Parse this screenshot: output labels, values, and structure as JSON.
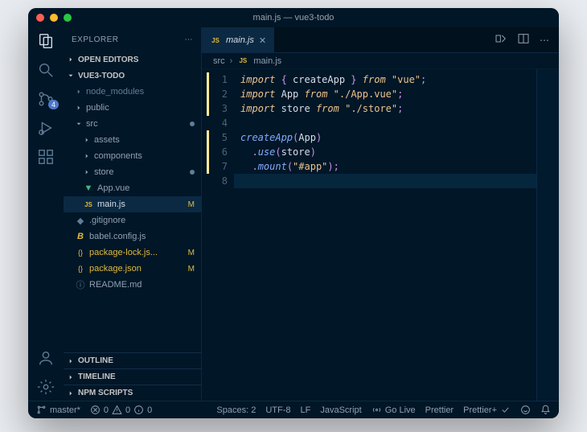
{
  "window": {
    "title": "main.js — vue3-todo"
  },
  "explorer": {
    "title": "EXPLORER",
    "sections": {
      "open_editors": "OPEN EDITORS",
      "project": "VUE3-TODO",
      "outline": "OUTLINE",
      "timeline": "TIMELINE",
      "npm_scripts": "NPM SCRIPTS"
    }
  },
  "tree": {
    "node_modules": "node_modules",
    "public": "public",
    "src": "src",
    "assets": "assets",
    "components": "components",
    "store": "store",
    "app_vue": "App.vue",
    "main_js": "main.js",
    "gitignore": ".gitignore",
    "babel": "babel.config.js",
    "package_lock": "package-lock.js...",
    "package_json": "package.json",
    "readme": "README.md"
  },
  "git_marks": {
    "main_js": "M",
    "package_lock": "M",
    "package_json": "M"
  },
  "tab": {
    "file": "main.js"
  },
  "breadcrumb": {
    "seg1": "src",
    "seg2": "main.js"
  },
  "activity_badge": "4",
  "code": {
    "lines": [
      {
        "n": "1",
        "tokens": [
          [
            "kw",
            "import"
          ],
          [
            "white",
            " "
          ],
          [
            "punc",
            "{ "
          ],
          [
            "id",
            "createApp"
          ],
          [
            "punc",
            " }"
          ],
          [
            "white",
            " "
          ],
          [
            "kw",
            "from"
          ],
          [
            "white",
            " "
          ],
          [
            "str",
            "\"vue\""
          ],
          [
            "punc",
            ";"
          ]
        ]
      },
      {
        "n": "2",
        "tokens": [
          [
            "kw",
            "import"
          ],
          [
            "white",
            " "
          ],
          [
            "id",
            "App"
          ],
          [
            "white",
            " "
          ],
          [
            "kw",
            "from"
          ],
          [
            "white",
            " "
          ],
          [
            "str",
            "\"./App.vue\""
          ],
          [
            "punc",
            ";"
          ]
        ]
      },
      {
        "n": "3",
        "tokens": [
          [
            "kw",
            "import"
          ],
          [
            "white",
            " "
          ],
          [
            "id",
            "store"
          ],
          [
            "white",
            " "
          ],
          [
            "kw",
            "from"
          ],
          [
            "white",
            " "
          ],
          [
            "str",
            "\"./store\""
          ],
          [
            "punc",
            ";"
          ]
        ]
      },
      {
        "n": "4",
        "tokens": []
      },
      {
        "n": "5",
        "tokens": [
          [
            "fn",
            "createApp"
          ],
          [
            "punc",
            "("
          ],
          [
            "id",
            "App"
          ],
          [
            "punc",
            ")"
          ]
        ]
      },
      {
        "n": "6",
        "tokens": [
          [
            "white",
            "  "
          ],
          [
            "punc",
            "."
          ],
          [
            "fn",
            "use"
          ],
          [
            "punc",
            "("
          ],
          [
            "id",
            "store"
          ],
          [
            "punc",
            ")"
          ]
        ]
      },
      {
        "n": "7",
        "tokens": [
          [
            "white",
            "  "
          ],
          [
            "punc",
            "."
          ],
          [
            "fn",
            "mount"
          ],
          [
            "punc",
            "("
          ],
          [
            "str",
            "\"#app\""
          ],
          [
            "punc",
            ");"
          ]
        ]
      },
      {
        "n": "8",
        "tokens": []
      }
    ],
    "highlight_line": 8
  },
  "status": {
    "branch": "master*",
    "errors": "0",
    "warnings": "0",
    "info": "0",
    "spaces": "Spaces: 2",
    "encoding": "UTF-8",
    "eol": "LF",
    "language": "JavaScript",
    "golive": "Go Live",
    "prettier": "Prettier",
    "prettierplus": "Prettier+"
  }
}
